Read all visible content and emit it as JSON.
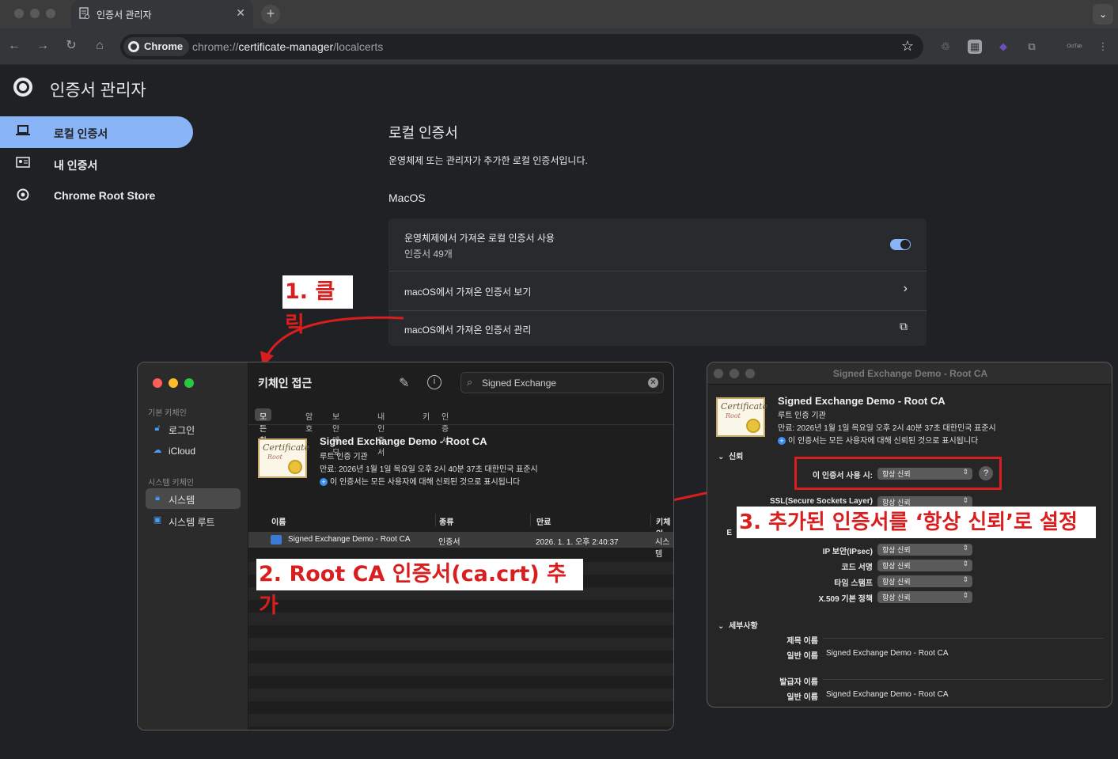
{
  "browser": {
    "tab_title": "인증서 관리자",
    "tab_close": "✕",
    "new_tab": "+",
    "tab_menu": "⌄",
    "chip_label": "Chrome",
    "url_prefix": "chrome://",
    "url_host": "certificate-manager",
    "url_path": "/localcerts",
    "profile_label": "OctTab"
  },
  "app": {
    "title": "인증서 관리자",
    "nav": [
      {
        "label": "로컬 인증서",
        "icon": "laptop-icon"
      },
      {
        "label": "내 인증서",
        "icon": "id-card-icon"
      },
      {
        "label": "Chrome Root Store",
        "icon": "chrome-icon"
      }
    ]
  },
  "content": {
    "section_title": "로컬 인증서",
    "section_desc": "운영체제 또는 관리자가 추가한 로컬 인증서입니다.",
    "macos_label": "MacOS",
    "rows": [
      {
        "title": "운영체제에서 가져온 로컬 인증서 사용",
        "subtitle": "인증서 49개",
        "toggle_on": true
      },
      {
        "title": "macOS에서 가져온 인증서 보기",
        "glyph": "›"
      },
      {
        "title": "macOS에서 가져온 인증서 관리",
        "glyph": "⧉"
      }
    ]
  },
  "annotations": {
    "step1": "1. 클릭",
    "step2": "2. Root CA 인증서(ca.crt) 추가",
    "step3": "3. 추가된 인증서를 ‘항상 신뢰’로 설정",
    "color": "#d81e1e"
  },
  "keychain": {
    "title": "키체인 접근",
    "search_value": "Signed Exchange",
    "sidebar": {
      "section1": "기본 키체인",
      "items1": [
        "로그인",
        "iCloud"
      ],
      "section2": "시스템 키체인",
      "items2": [
        "시스템",
        "시스템 루트"
      ]
    },
    "tabs": [
      "모든 항목",
      "암호",
      "보안 메모",
      "내 인증서",
      "키",
      "인증서"
    ],
    "cert": {
      "name": "Signed Exchange Demo - Root CA",
      "kind": "루트 인증 기관",
      "expiry": "만료: 2026년 1월 1일 목요일 오후 2시 40분 37초 대한민국 표준시",
      "trust": "이 인증서는 모든 사용자에 대해 신뢰된 것으로 표시됩니다",
      "icon_caption": "Certificate",
      "icon_subcaption": "Root"
    },
    "columns": [
      "이름",
      "종류",
      "만료",
      "키체인"
    ],
    "rows": [
      {
        "name": "Signed Exchange Demo - Root CA",
        "kind": "인증서",
        "expires": "2026. 1. 1. 오후 2:40:37",
        "keychain": "시스템"
      }
    ]
  },
  "detail": {
    "window_title": "Signed Exchange Demo - Root CA",
    "cert_name": "Signed Exchange Demo - Root CA",
    "cert_kind": "루트 인증 기관",
    "cert_expiry": "만료: 2026년 1월 1일 목요일 오후 2시 40분 37초 대한민국 표준시",
    "cert_trust": "이 인증서는 모든 사용자에 대해 신뢰된 것으로 표시됩니다",
    "trust_section": "신뢰",
    "when_using_label": "이 인증서 사용 시:",
    "when_using_value": "항상 신뢰",
    "help": "?",
    "policies": [
      {
        "label": "SSL(Secure Sockets Layer)",
        "value": "항상 신뢰"
      },
      {
        "label": "E",
        "value": ""
      },
      {
        "label": "IP 보안(IPsec)",
        "value": "항상 신뢰"
      },
      {
        "label": "코드 서명",
        "value": "항상 신뢰"
      },
      {
        "label": "타임 스탬프",
        "value": "항상 신뢰"
      },
      {
        "label": "X.509 기본 정책",
        "value": "항상 신뢰"
      }
    ],
    "details_section": "세부사항",
    "subject_label": "제목 이름",
    "subject_cn_label": "일반 이름",
    "subject_cn_value": "Signed Exchange Demo - Root CA",
    "issuer_label": "발급자 이름",
    "issuer_cn_label": "일반 이름",
    "issuer_cn_value": "Signed Exchange Demo - Root CA"
  }
}
